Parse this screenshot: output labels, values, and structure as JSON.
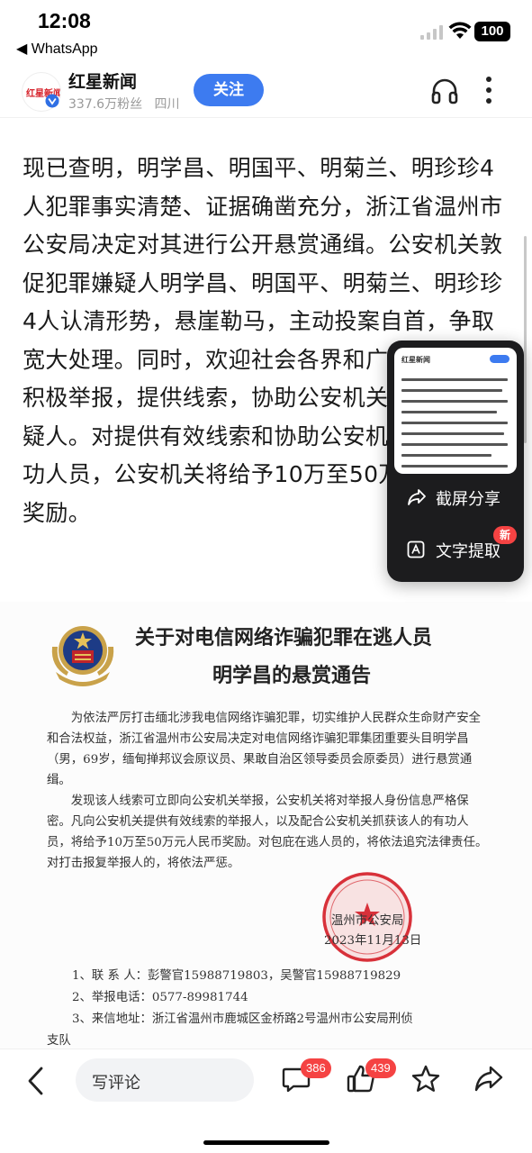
{
  "status_bar": {
    "time": "12:08",
    "back_app": "◀ WhatsApp",
    "battery": "100"
  },
  "header": {
    "logo_text": "红星新闻",
    "account_name": "红星新闻",
    "followers": "337.6万粉丝",
    "region": "四川",
    "follow_label": "关注"
  },
  "article": {
    "paragraph": "现已查明，明学昌、明国平、明菊兰、明珍珍4人犯罪事实清楚、证据确凿充分，浙江省温州市公安局决定对其进行公开悬赏通缉。公安机关敦促犯罪嫌疑人明学昌、明国平、明菊兰、明珍珍4人认清形势，悬崖勒马，主动投案自首，争取宽大处理。同时，欢迎社会各界和广大人民群众积极举报，提供线索，协助公安机关缉拿犯罪嫌疑人。对提供有效线索和协助公安机关抓获的有功人员，公安机关将给予10万至50万元人民币奖励。"
  },
  "notice": {
    "title_line1": "关于对电信网络诈骗犯罪在逃人员",
    "title_line2": "明学昌的悬赏通告",
    "para1": "为依法严厉打击缅北涉我电信网络诈骗犯罪，切实维护人民群众生命财产安全和合法权益，浙江省温州市公安局决定对电信网络诈骗犯罪集团重要头目明学昌（男，69岁，缅甸掸邦议会原议员、果敢自治区领导委员会原委员）进行悬赏通缉。",
    "para2": "发现该人线索可立即向公安机关举报，公安机关将对举报人身份信息严格保密。凡向公安机关提供有效线索的举报人，以及配合公安机关抓获该人的有功人员，将给予10万至50万元人民币奖励。对包庇在逃人员的，将依法追究法律责任。对打击报复举报人的，将依法严惩。",
    "org": "温州市公安局",
    "date": "2023年11月13日",
    "contacts": [
      "1、联 系 人：彭警官15988719803，吴警官15988719829",
      "2、举报电话：0577-89981744",
      "3、来信地址：浙江省温州市鹿城区金桥路2号温州市公安局刑侦"
    ],
    "contacts_tail": "支队"
  },
  "popup": {
    "thumb_title": "红星新闻",
    "screenshot_share": "截屏分享",
    "text_extract": "文字提取",
    "new_badge": "新"
  },
  "bottom_bar": {
    "comment_placeholder": "写评论",
    "comment_count": "386",
    "like_count": "439"
  },
  "colors": {
    "accent_blue": "#3d7bf0",
    "badge_red": "#f54343",
    "popup_bg": "#1c1c1e"
  }
}
